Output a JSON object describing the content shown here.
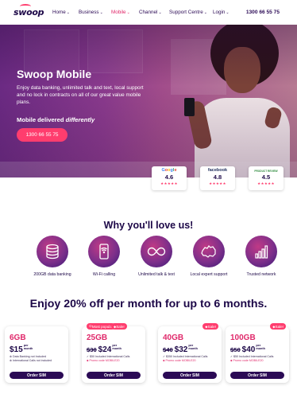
{
  "nav": {
    "logo": "swoop",
    "items": [
      "Home",
      "Business",
      "Mobile",
      "Channel",
      "Support Centre",
      "Login"
    ],
    "active": "Mobile",
    "phone": "1300 66 55 75"
  },
  "hero": {
    "title": "Swoop Mobile",
    "description": "Enjoy data banking, unlimited talk and text, local support and no lock in contracts on all of our great value mobile plans.",
    "subtitle_lead": "Mobile delivered",
    "subtitle_em": "differently",
    "button": "1300 66 55 75"
  },
  "reviews": [
    {
      "brand": "Google",
      "rating": "4.6",
      "stars": "★★★★★"
    },
    {
      "brand": "facebook",
      "rating": "4.8",
      "stars": "★★★★★"
    },
    {
      "brand": "PRODUCT REVIEW",
      "rating": "4.5",
      "stars": "★★★★★"
    }
  ],
  "why": {
    "title": "Why you'll love us!",
    "features": [
      {
        "label": "200GB data banking",
        "icon": "database-icon"
      },
      {
        "label": "Wi-Fi calling",
        "icon": "wifi-phone-icon"
      },
      {
        "label": "Unlimited talk & text",
        "icon": "infinity-icon"
      },
      {
        "label": "Local expert support",
        "icon": "australia-map-icon"
      },
      {
        "label": "Trusted network",
        "icon": "signal-bars-icon"
      }
    ]
  },
  "promo": {
    "text": "Enjoy 20% off per month for up to 6 months."
  },
  "plans": [
    {
      "data": "6GB",
      "old_price": "",
      "price": "$15",
      "per": "per month",
      "features": [
        "Data Banking not Included",
        "International Calls not included"
      ],
      "promo": "",
      "popular": false,
      "sale": false,
      "button": "Order SIM"
    },
    {
      "data": "25GB",
      "old_price": "$30",
      "price": "$24",
      "per": "per month",
      "features": [
        "$50 Included International Calls"
      ],
      "promo": "Promo code MOBILE20",
      "popular": true,
      "popular_label": "Most popular",
      "sale": true,
      "sale_label": "Sale!",
      "button": "Order SIM"
    },
    {
      "data": "40GB",
      "old_price": "$40",
      "price": "$32",
      "per": "per month",
      "features": [
        "$350 Included International Calls"
      ],
      "promo": "Promo code MOBILE20",
      "popular": false,
      "sale": true,
      "sale_label": "Sale!",
      "button": "Order SIM"
    },
    {
      "data": "100GB",
      "old_price": "$50",
      "price": "$40",
      "per": "per month",
      "features": [
        "$50 Included International Calls"
      ],
      "promo": "Promo code MOBILE20",
      "popular": false,
      "sale": true,
      "sale_label": "Sale!",
      "button": "Order SIM"
    }
  ],
  "colors": {
    "primary": "#2b0a55",
    "accent": "#ff3d6e",
    "hero": "#8a3a8d"
  }
}
